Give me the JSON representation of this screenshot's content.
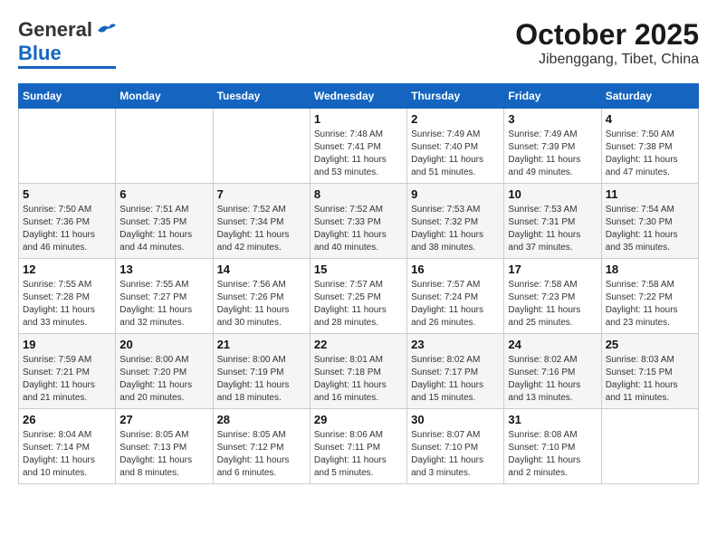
{
  "header": {
    "logo_general": "General",
    "logo_blue": "Blue",
    "month_title": "October 2025",
    "subtitle": "Jibenggang, Tibet, China"
  },
  "days_of_week": [
    "Sunday",
    "Monday",
    "Tuesday",
    "Wednesday",
    "Thursday",
    "Friday",
    "Saturday"
  ],
  "weeks": [
    [
      {
        "day": "",
        "info": ""
      },
      {
        "day": "",
        "info": ""
      },
      {
        "day": "",
        "info": ""
      },
      {
        "day": "1",
        "info": "Sunrise: 7:48 AM\nSunset: 7:41 PM\nDaylight: 11 hours and 53 minutes."
      },
      {
        "day": "2",
        "info": "Sunrise: 7:49 AM\nSunset: 7:40 PM\nDaylight: 11 hours and 51 minutes."
      },
      {
        "day": "3",
        "info": "Sunrise: 7:49 AM\nSunset: 7:39 PM\nDaylight: 11 hours and 49 minutes."
      },
      {
        "day": "4",
        "info": "Sunrise: 7:50 AM\nSunset: 7:38 PM\nDaylight: 11 hours and 47 minutes."
      }
    ],
    [
      {
        "day": "5",
        "info": "Sunrise: 7:50 AM\nSunset: 7:36 PM\nDaylight: 11 hours and 46 minutes."
      },
      {
        "day": "6",
        "info": "Sunrise: 7:51 AM\nSunset: 7:35 PM\nDaylight: 11 hours and 44 minutes."
      },
      {
        "day": "7",
        "info": "Sunrise: 7:52 AM\nSunset: 7:34 PM\nDaylight: 11 hours and 42 minutes."
      },
      {
        "day": "8",
        "info": "Sunrise: 7:52 AM\nSunset: 7:33 PM\nDaylight: 11 hours and 40 minutes."
      },
      {
        "day": "9",
        "info": "Sunrise: 7:53 AM\nSunset: 7:32 PM\nDaylight: 11 hours and 38 minutes."
      },
      {
        "day": "10",
        "info": "Sunrise: 7:53 AM\nSunset: 7:31 PM\nDaylight: 11 hours and 37 minutes."
      },
      {
        "day": "11",
        "info": "Sunrise: 7:54 AM\nSunset: 7:30 PM\nDaylight: 11 hours and 35 minutes."
      }
    ],
    [
      {
        "day": "12",
        "info": "Sunrise: 7:55 AM\nSunset: 7:28 PM\nDaylight: 11 hours and 33 minutes."
      },
      {
        "day": "13",
        "info": "Sunrise: 7:55 AM\nSunset: 7:27 PM\nDaylight: 11 hours and 32 minutes."
      },
      {
        "day": "14",
        "info": "Sunrise: 7:56 AM\nSunset: 7:26 PM\nDaylight: 11 hours and 30 minutes."
      },
      {
        "day": "15",
        "info": "Sunrise: 7:57 AM\nSunset: 7:25 PM\nDaylight: 11 hours and 28 minutes."
      },
      {
        "day": "16",
        "info": "Sunrise: 7:57 AM\nSunset: 7:24 PM\nDaylight: 11 hours and 26 minutes."
      },
      {
        "day": "17",
        "info": "Sunrise: 7:58 AM\nSunset: 7:23 PM\nDaylight: 11 hours and 25 minutes."
      },
      {
        "day": "18",
        "info": "Sunrise: 7:58 AM\nSunset: 7:22 PM\nDaylight: 11 hours and 23 minutes."
      }
    ],
    [
      {
        "day": "19",
        "info": "Sunrise: 7:59 AM\nSunset: 7:21 PM\nDaylight: 11 hours and 21 minutes."
      },
      {
        "day": "20",
        "info": "Sunrise: 8:00 AM\nSunset: 7:20 PM\nDaylight: 11 hours and 20 minutes."
      },
      {
        "day": "21",
        "info": "Sunrise: 8:00 AM\nSunset: 7:19 PM\nDaylight: 11 hours and 18 minutes."
      },
      {
        "day": "22",
        "info": "Sunrise: 8:01 AM\nSunset: 7:18 PM\nDaylight: 11 hours and 16 minutes."
      },
      {
        "day": "23",
        "info": "Sunrise: 8:02 AM\nSunset: 7:17 PM\nDaylight: 11 hours and 15 minutes."
      },
      {
        "day": "24",
        "info": "Sunrise: 8:02 AM\nSunset: 7:16 PM\nDaylight: 11 hours and 13 minutes."
      },
      {
        "day": "25",
        "info": "Sunrise: 8:03 AM\nSunset: 7:15 PM\nDaylight: 11 hours and 11 minutes."
      }
    ],
    [
      {
        "day": "26",
        "info": "Sunrise: 8:04 AM\nSunset: 7:14 PM\nDaylight: 11 hours and 10 minutes."
      },
      {
        "day": "27",
        "info": "Sunrise: 8:05 AM\nSunset: 7:13 PM\nDaylight: 11 hours and 8 minutes."
      },
      {
        "day": "28",
        "info": "Sunrise: 8:05 AM\nSunset: 7:12 PM\nDaylight: 11 hours and 6 minutes."
      },
      {
        "day": "29",
        "info": "Sunrise: 8:06 AM\nSunset: 7:11 PM\nDaylight: 11 hours and 5 minutes."
      },
      {
        "day": "30",
        "info": "Sunrise: 8:07 AM\nSunset: 7:10 PM\nDaylight: 11 hours and 3 minutes."
      },
      {
        "day": "31",
        "info": "Sunrise: 8:08 AM\nSunset: 7:10 PM\nDaylight: 11 hours and 2 minutes."
      },
      {
        "day": "",
        "info": ""
      }
    ]
  ]
}
